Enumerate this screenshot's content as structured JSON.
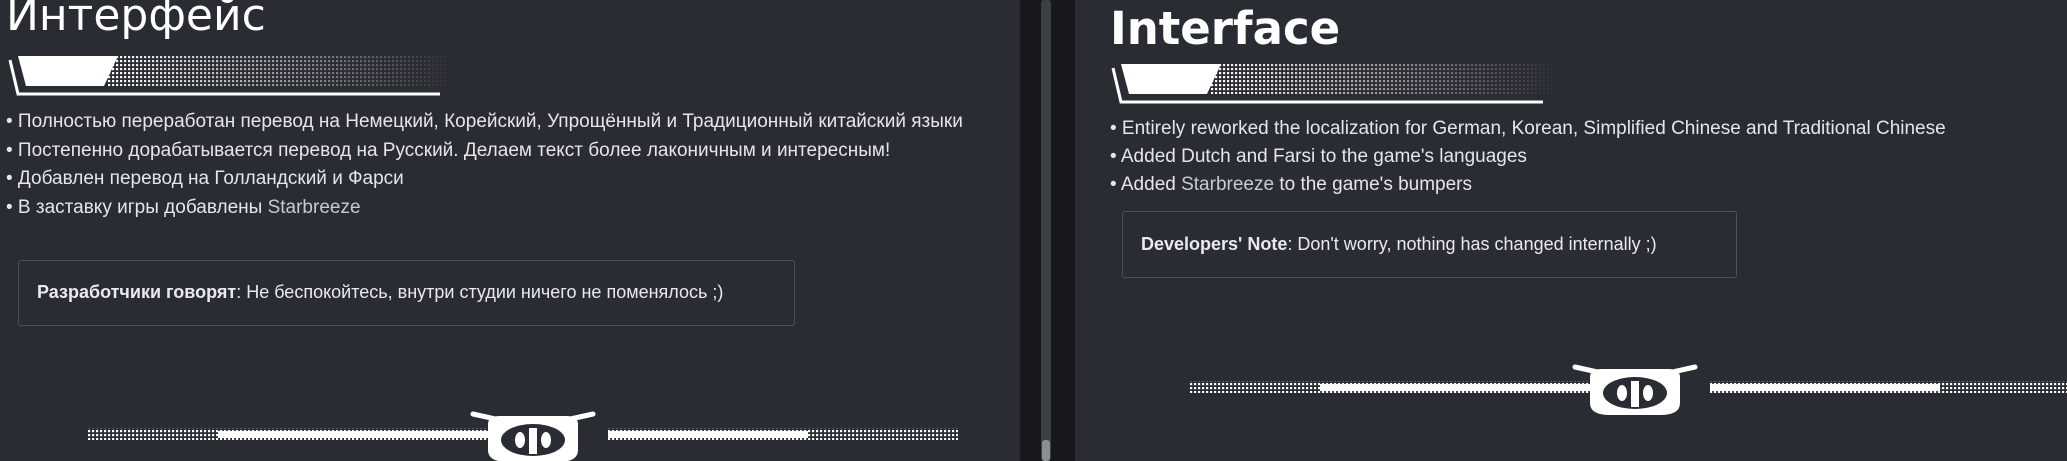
{
  "left": {
    "heading": "Интерфейс",
    "items": [
      {
        "text": "• Полностью переработан перевод на Немецкий, Корейский, Упрощённый и Традиционный китайский языки"
      },
      {
        "text": "• Постепенно дорабатывается перевод на Русский. Делаем текст более лаконичным и интересным!"
      },
      {
        "text": "• Добавлен перевод на Голландский и Фарси"
      },
      {
        "text_prefix": "• В заставку игры добавлены ",
        "highlight": "Starbreeze"
      }
    ],
    "note": {
      "label": "Разработчики говорят",
      "text": ": Не беспокойтесь, внутри студии ничего не поменялось ;)"
    }
  },
  "right": {
    "heading": "Interface",
    "items": [
      {
        "text": "• Entirely reworked the localization for German, Korean, Simplified Chinese and Traditional Chinese"
      },
      {
        "text": "• Added Dutch and Farsi to the game's languages"
      },
      {
        "text_prefix": "• Added ",
        "highlight": "Starbreeze",
        "text_suffix": " to the game's bumpers"
      }
    ],
    "note": {
      "label": "Developers' Note",
      "text": ": Don't worry, nothing has changed internally ;)"
    }
  },
  "icons": {
    "heading_underline": "brush-stroke-underline-icon",
    "divider_emblem": "robot-head-emblem-icon"
  },
  "colors": {
    "background": "#2a2c33",
    "text": "#e4e6ea",
    "heading": "#ffffff",
    "note_border": "#4d5058"
  }
}
